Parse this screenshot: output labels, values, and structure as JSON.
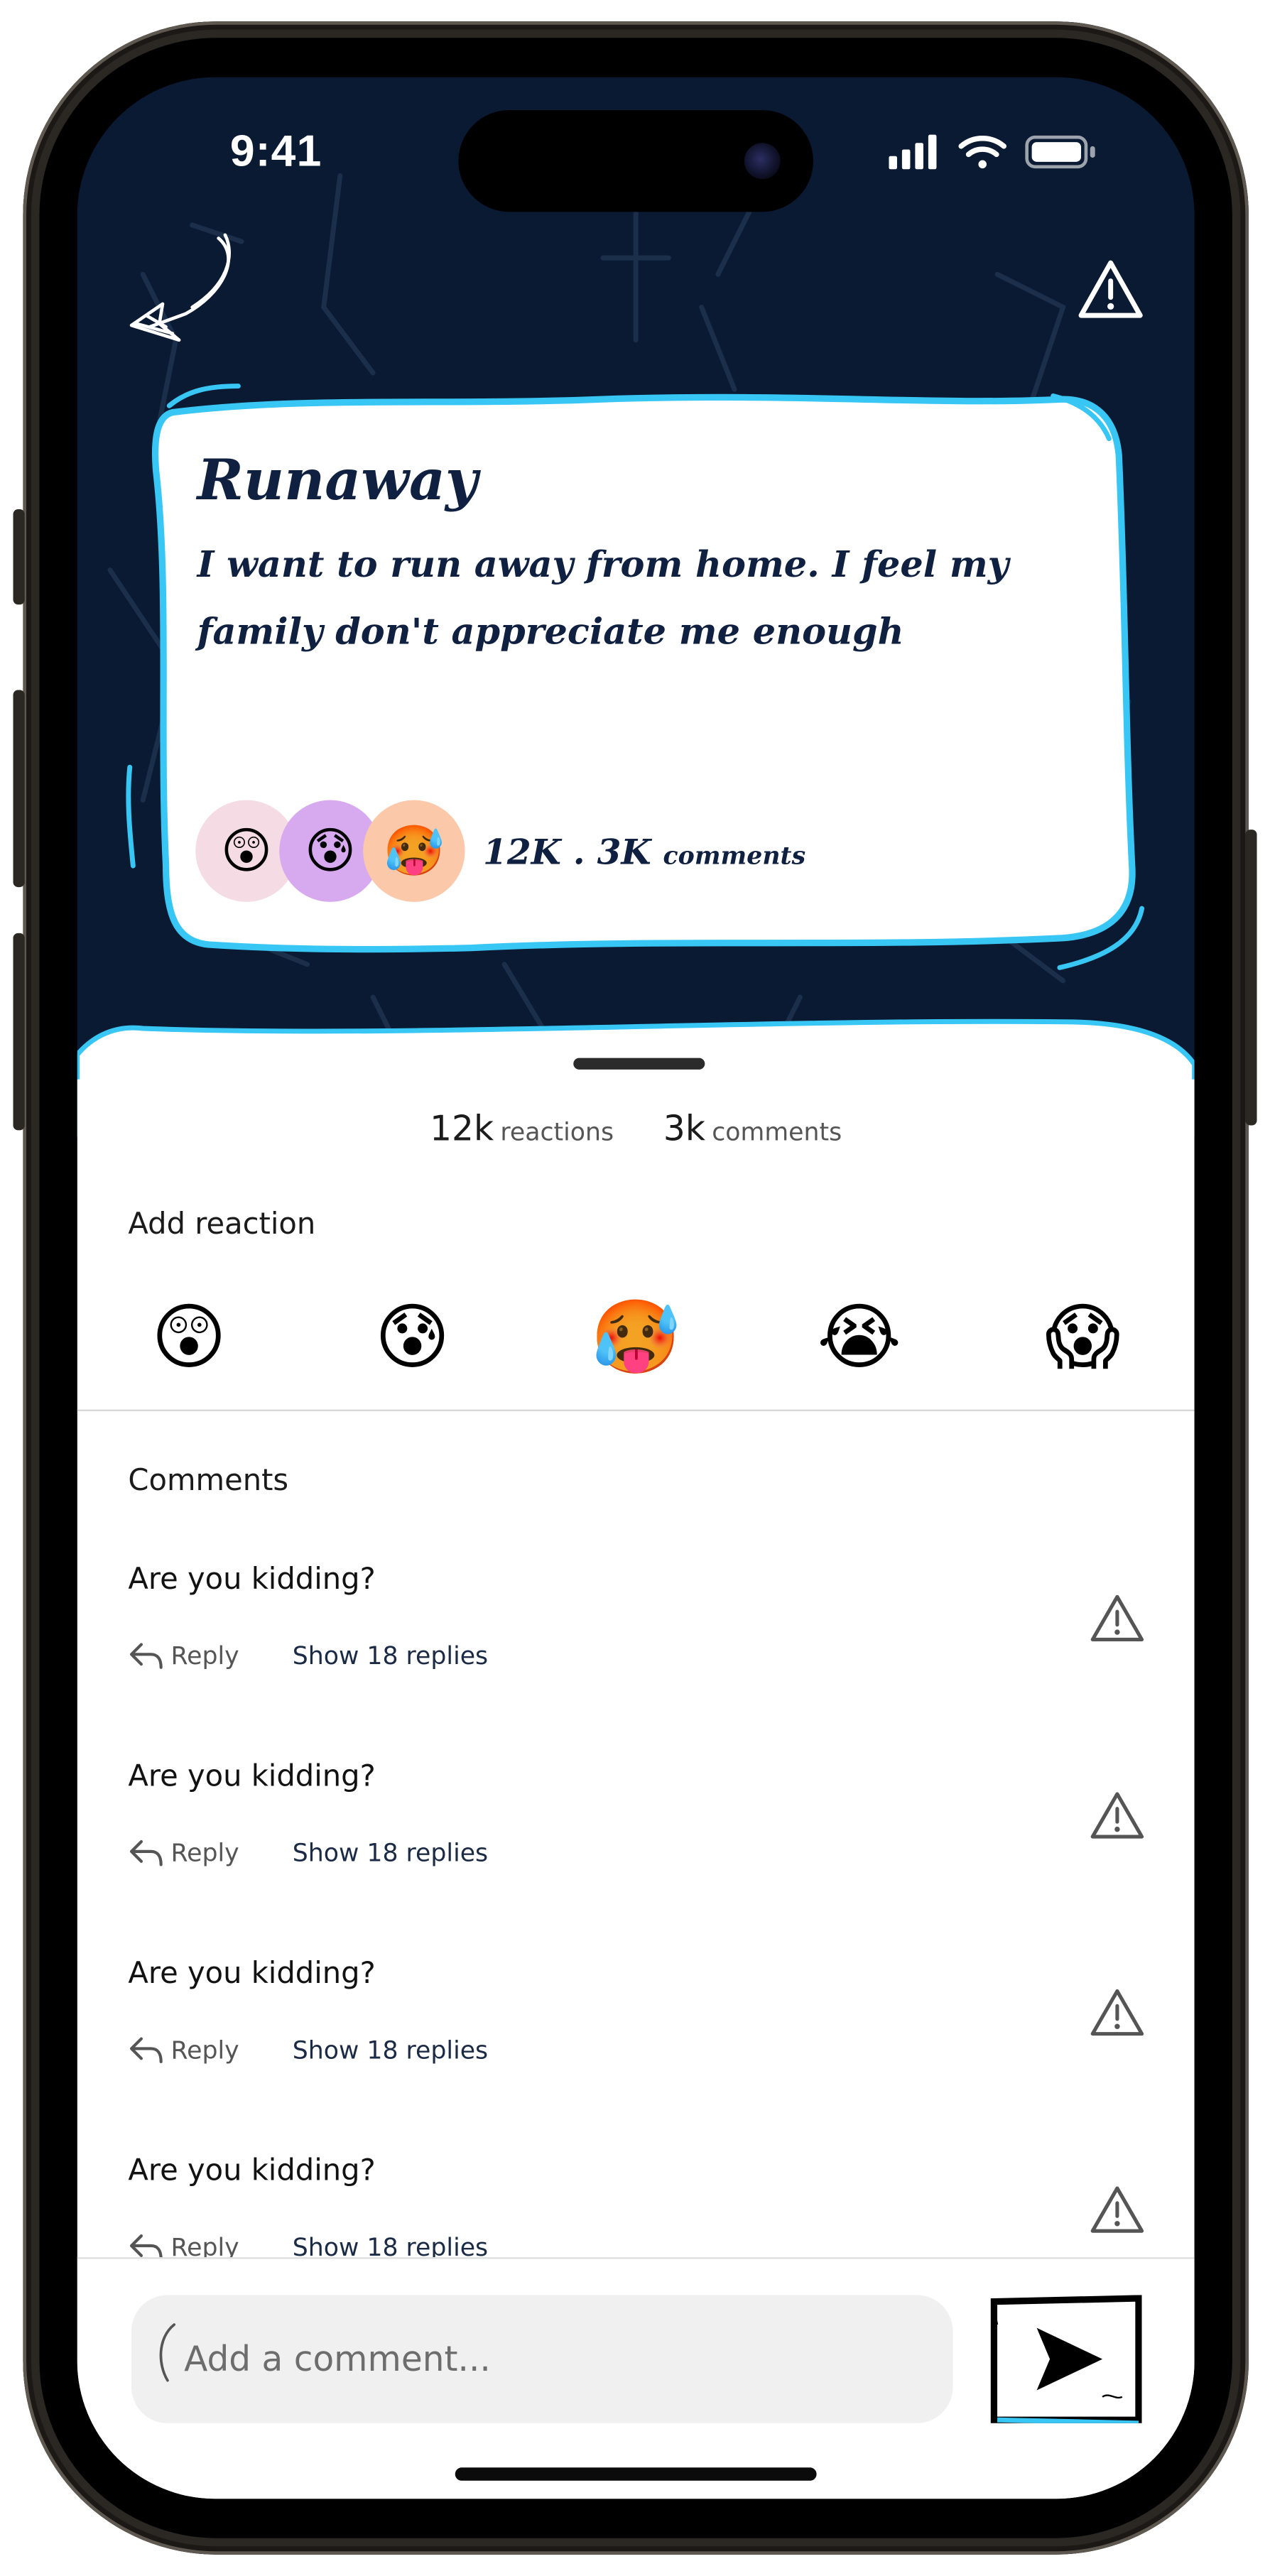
{
  "status_bar": {
    "time": "9:41"
  },
  "post": {
    "title": "Runaway",
    "body": "I want to run away from home. I feel my family don't appreciate me enough",
    "reaction_emojis": [
      "😲",
      "😰",
      "🥵"
    ],
    "meta_count": "12K . 3K",
    "meta_label": "comments"
  },
  "stats": {
    "reactions_count": "12k",
    "reactions_label": "reactions",
    "comments_count": "3k",
    "comments_label": "comments"
  },
  "add_reaction": {
    "label": "Add reaction",
    "emojis": [
      "😲",
      "😰",
      "🥵",
      "😭",
      "😱"
    ]
  },
  "comments": {
    "label": "Comments",
    "items": [
      {
        "text": "Are you kidding?",
        "reply_label": "Reply",
        "replies_label": "Show 18 replies"
      },
      {
        "text": "Are you kidding?",
        "reply_label": "Reply",
        "replies_label": "Show 18 replies"
      },
      {
        "text": "Are you kidding?",
        "reply_label": "Reply",
        "replies_label": "Show 18 replies"
      },
      {
        "text": "Are you kidding?",
        "reply_label": "Reply",
        "replies_label": "Show 18 replies"
      }
    ]
  },
  "composer": {
    "placeholder": "Add a comment..."
  },
  "colors": {
    "background_navy": "#0a1a33",
    "card_outline": "#38c6f4",
    "text_navy": "#0f2040"
  },
  "icons": [
    "back-arrow-icon",
    "warning-icon",
    "reply-arrow-icon",
    "send-icon"
  ]
}
